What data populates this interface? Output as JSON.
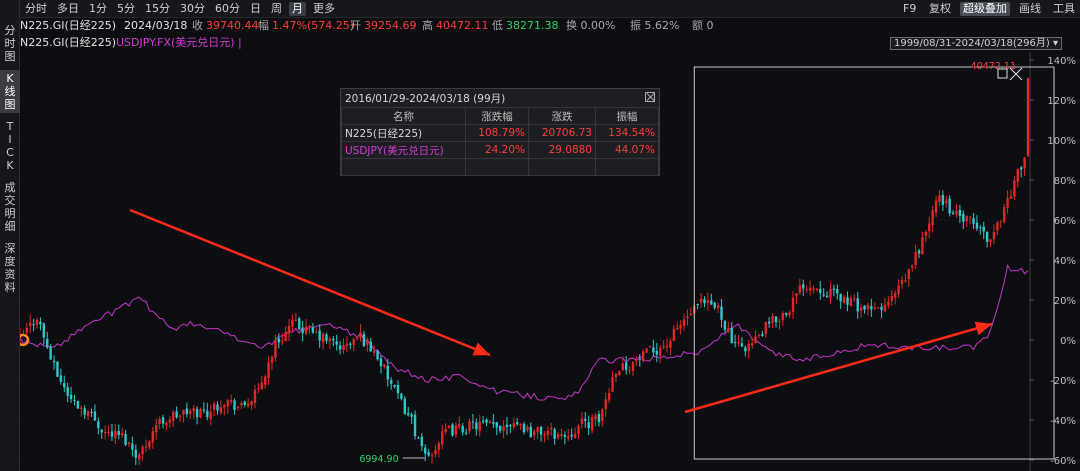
{
  "sidebar": {
    "items": [
      {
        "label": "分时图",
        "active": false
      },
      {
        "label": "K线图",
        "active": true
      },
      {
        "label": "TICK",
        "active": false
      },
      {
        "label": "成交明细",
        "active": false
      },
      {
        "label": "深度资料",
        "active": false
      }
    ]
  },
  "toolbar": {
    "periods": [
      "分时",
      "多日",
      "1分",
      "5分",
      "15分",
      "30分",
      "60分",
      "日",
      "周",
      "月",
      "更多"
    ],
    "active_period": "月",
    "right_items": [
      "F9",
      "复权",
      "超级叠加",
      "画线",
      "工具"
    ],
    "highlight_item": "超级叠加"
  },
  "quote": {
    "symbol": "N225.GI(日经225)",
    "date": "2024/03/18",
    "close_label": "收",
    "close": "39740.44",
    "change_label": "幅",
    "change": "1.47%(574.25)",
    "open_label": "开",
    "open": "39254.69",
    "high_label": "高",
    "high": "40472.11",
    "low_label": "低",
    "low": "38271.38",
    "turnover": "换 0.00%",
    "amplitude": "振 5.62%",
    "amount": "额 0"
  },
  "legend": {
    "main": "N225.GI(日经225)",
    "overlay": "USDJPY.FX(美元兑日元)",
    "range": "1999/08/31-2024/03/18(296月)"
  },
  "popup": {
    "title": "2016/01/29-2024/03/18 (99月)",
    "headers": [
      "名称",
      "涨跌幅",
      "涨跌",
      "振幅"
    ],
    "rows": [
      {
        "name": "N225(日经225)",
        "pct": "108.79%",
        "chg": "20706.73",
        "amp": "134.54%"
      },
      {
        "name": "USDJPY(美元兑日元)",
        "pct": "24.20%",
        "chg": "29.0880",
        "amp": "44.07%"
      }
    ]
  },
  "chart_data": {
    "type": "candlestick",
    "ylim": [
      -60,
      140
    ],
    "yticks": [
      "140%",
      "120%",
      "100%",
      "80%",
      "60%",
      "40%",
      "20%",
      "0%",
      "-20%",
      "-40%",
      "-60%"
    ],
    "annotations": {
      "max_label": "40472.11",
      "min_label": "6994.90"
    },
    "colors": {
      "up": "#e02626",
      "down": "#2fc8c8",
      "overlay": "#c534c9",
      "arrow": "#ff2a1a"
    },
    "series": [
      {
        "name": "N225.GI(日经225)",
        "unit": "% change",
        "points": [
          [
            0,
            0
          ],
          [
            5,
            12
          ],
          [
            10,
            -14
          ],
          [
            15,
            -30
          ],
          [
            20,
            -36
          ],
          [
            25,
            -46
          ],
          [
            30,
            -48
          ],
          [
            35,
            -58
          ],
          [
            40,
            -42
          ],
          [
            45,
            -38
          ],
          [
            50,
            -36
          ],
          [
            55,
            -36
          ],
          [
            60,
            -30
          ],
          [
            65,
            -34
          ],
          [
            70,
            -26
          ],
          [
            75,
            -2
          ],
          [
            80,
            8
          ],
          [
            85,
            4
          ],
          [
            90,
            0
          ],
          [
            95,
            -4
          ],
          [
            100,
            2
          ],
          [
            105,
            -8
          ],
          [
            110,
            -26
          ],
          [
            115,
            -40
          ],
          [
            118,
            -56
          ],
          [
            120,
            -58
          ],
          [
            125,
            -46
          ],
          [
            130,
            -44
          ],
          [
            135,
            -42
          ],
          [
            140,
            -44
          ],
          [
            145,
            -40
          ],
          [
            150,
            -46
          ],
          [
            155,
            -46
          ],
          [
            160,
            -48
          ],
          [
            165,
            -42
          ],
          [
            170,
            -40
          ],
          [
            175,
            -14
          ],
          [
            180,
            -12
          ],
          [
            185,
            -6
          ],
          [
            190,
            -2
          ],
          [
            195,
            10
          ],
          [
            200,
            18
          ],
          [
            205,
            16
          ],
          [
            210,
            -4
          ],
          [
            215,
            -2
          ],
          [
            220,
            8
          ],
          [
            225,
            14
          ],
          [
            230,
            28
          ],
          [
            235,
            26
          ],
          [
            240,
            22
          ],
          [
            245,
            18
          ],
          [
            250,
            14
          ],
          [
            255,
            18
          ],
          [
            260,
            30
          ],
          [
            265,
            50
          ],
          [
            270,
            72
          ],
          [
            275,
            62
          ],
          [
            280,
            58
          ],
          [
            285,
            50
          ],
          [
            290,
            70
          ],
          [
            295,
            92
          ],
          [
            296,
            128
          ]
        ]
      },
      {
        "name": "USDJPY.FX(美元兑日元)",
        "unit": "% change",
        "points": [
          [
            0,
            0
          ],
          [
            10,
            -4
          ],
          [
            20,
            8
          ],
          [
            30,
            16
          ],
          [
            35,
            22
          ],
          [
            40,
            12
          ],
          [
            45,
            6
          ],
          [
            50,
            8
          ],
          [
            60,
            4
          ],
          [
            70,
            -4
          ],
          [
            80,
            4
          ],
          [
            90,
            8
          ],
          [
            100,
            2
          ],
          [
            110,
            -14
          ],
          [
            120,
            -20
          ],
          [
            130,
            -18
          ],
          [
            140,
            -26
          ],
          [
            150,
            -28
          ],
          [
            160,
            -30
          ],
          [
            165,
            -24
          ],
          [
            170,
            -10
          ],
          [
            180,
            -10
          ],
          [
            190,
            -8
          ],
          [
            200,
            -6
          ],
          [
            210,
            8
          ],
          [
            220,
            -6
          ],
          [
            230,
            -10
          ],
          [
            240,
            -6
          ],
          [
            250,
            -2
          ],
          [
            260,
            -4
          ],
          [
            270,
            -4
          ],
          [
            280,
            -4
          ],
          [
            285,
            4
          ],
          [
            290,
            36
          ],
          [
            295,
            34
          ],
          [
            296,
            36
          ]
        ]
      }
    ],
    "selection": {
      "start": 198,
      "end": 296
    }
  }
}
